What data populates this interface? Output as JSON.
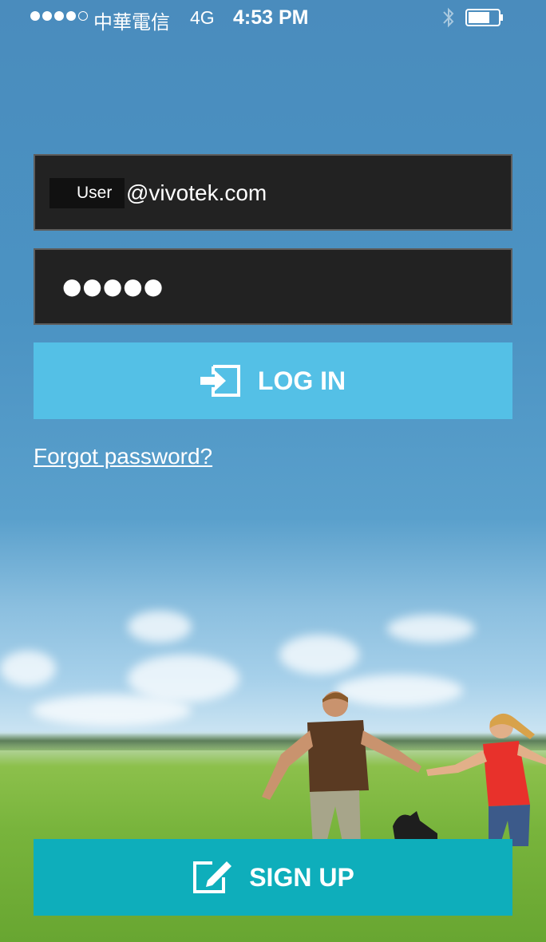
{
  "status_bar": {
    "carrier": "中華電信",
    "network": "4G",
    "time": "4:53 PM"
  },
  "login_form": {
    "email_user": "User",
    "email_domain": "@vivotek.com",
    "password_masked": "●●●●●",
    "login_label": "LOG IN",
    "forgot_label": "Forgot password?",
    "signup_label": "SIGN UP"
  },
  "icons": {
    "signal": "signal-dots-icon",
    "bluetooth": "bluetooth-icon",
    "battery": "battery-icon",
    "login": "login-arrow-icon",
    "signup": "edit-pencil-icon"
  },
  "colors": {
    "login_button": "#54c0e6",
    "signup_button": "#0eaebb",
    "field_bg": "#222222",
    "sky": "#4a8cbd"
  }
}
